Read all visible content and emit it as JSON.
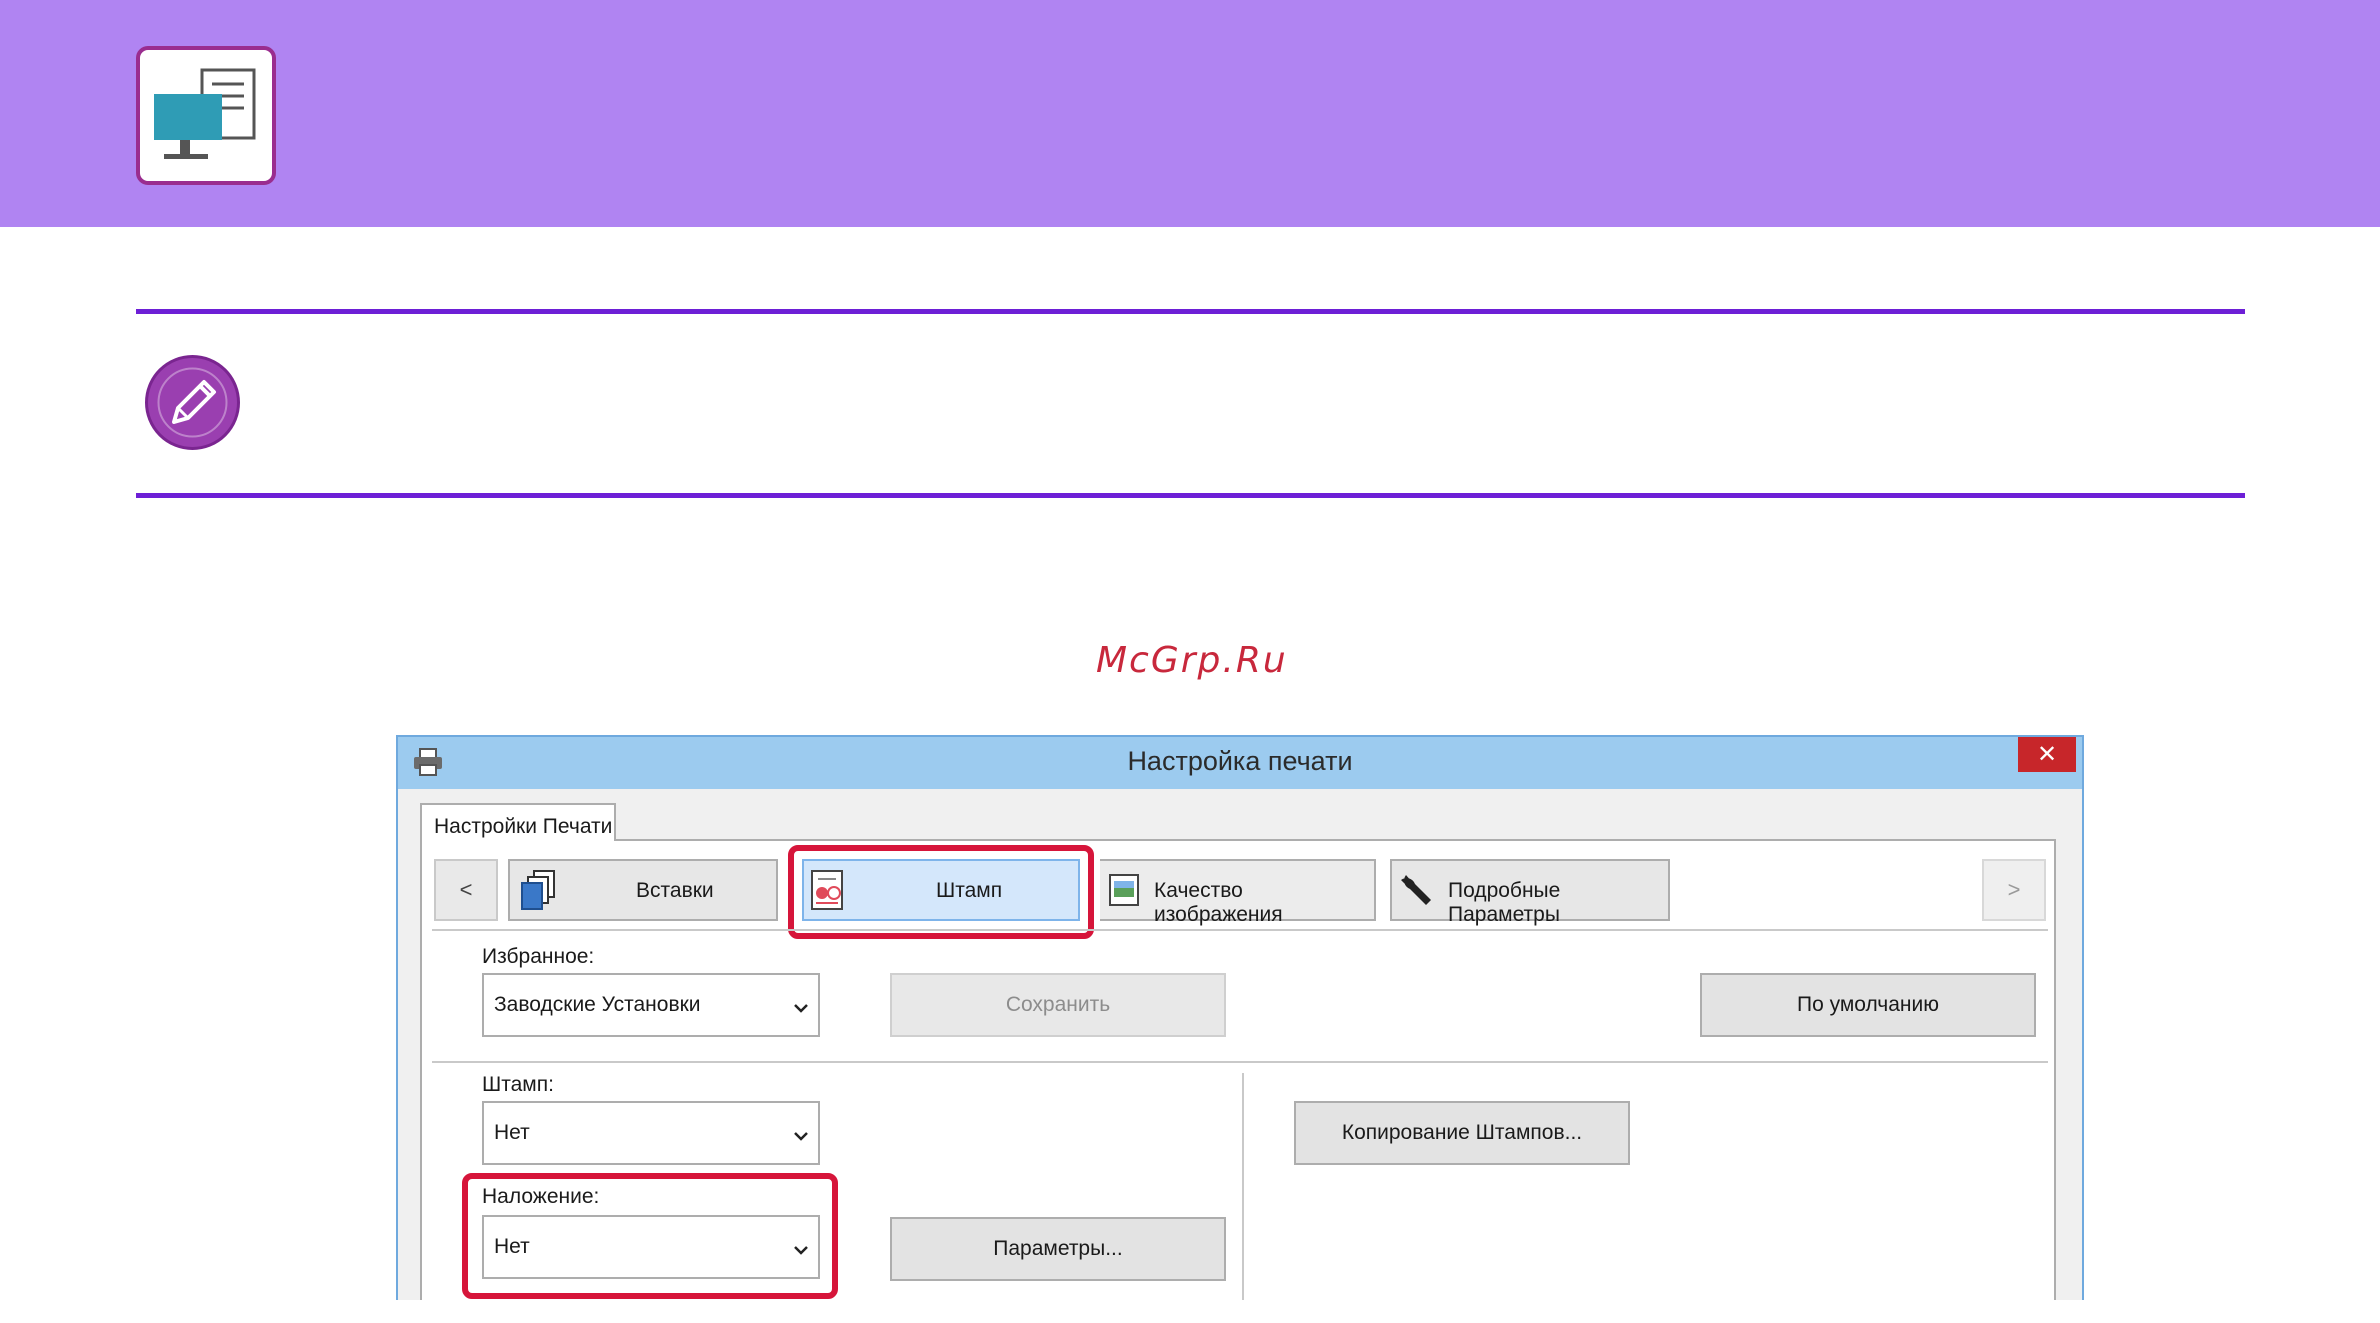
{
  "watermark": "McGrp.Ru",
  "dialog": {
    "title": "Настройка печати",
    "close_glyph": "✕",
    "tab_label": "Настройки Печати",
    "nav": {
      "prev": "<",
      "next": ">"
    },
    "feature_tabs": [
      {
        "label": "Вставки",
        "icon": "inserts-icon"
      },
      {
        "label": "Штамп",
        "icon": "stamp-icon",
        "selected": true
      },
      {
        "label": "Качество изображения",
        "icon": "image-quality-icon"
      },
      {
        "label": "Подробные Параметры",
        "icon": "wrench-icon"
      }
    ],
    "favorites": {
      "label": "Избранное:",
      "value": "Заводские Установки",
      "save_label": "Сохранить",
      "default_label": "По умолчанию"
    },
    "stamp": {
      "label": "Штамп:",
      "value": "Нет",
      "copy_label": "Копирование Штампов..."
    },
    "overlay": {
      "label": "Наложение:",
      "value": "Нет",
      "params_label": "Параметры..."
    }
  },
  "colors": {
    "banner": "#b084f2",
    "rule": "#6d1fd6",
    "highlight": "#d6153a",
    "titlebar": "#9ccbef"
  }
}
